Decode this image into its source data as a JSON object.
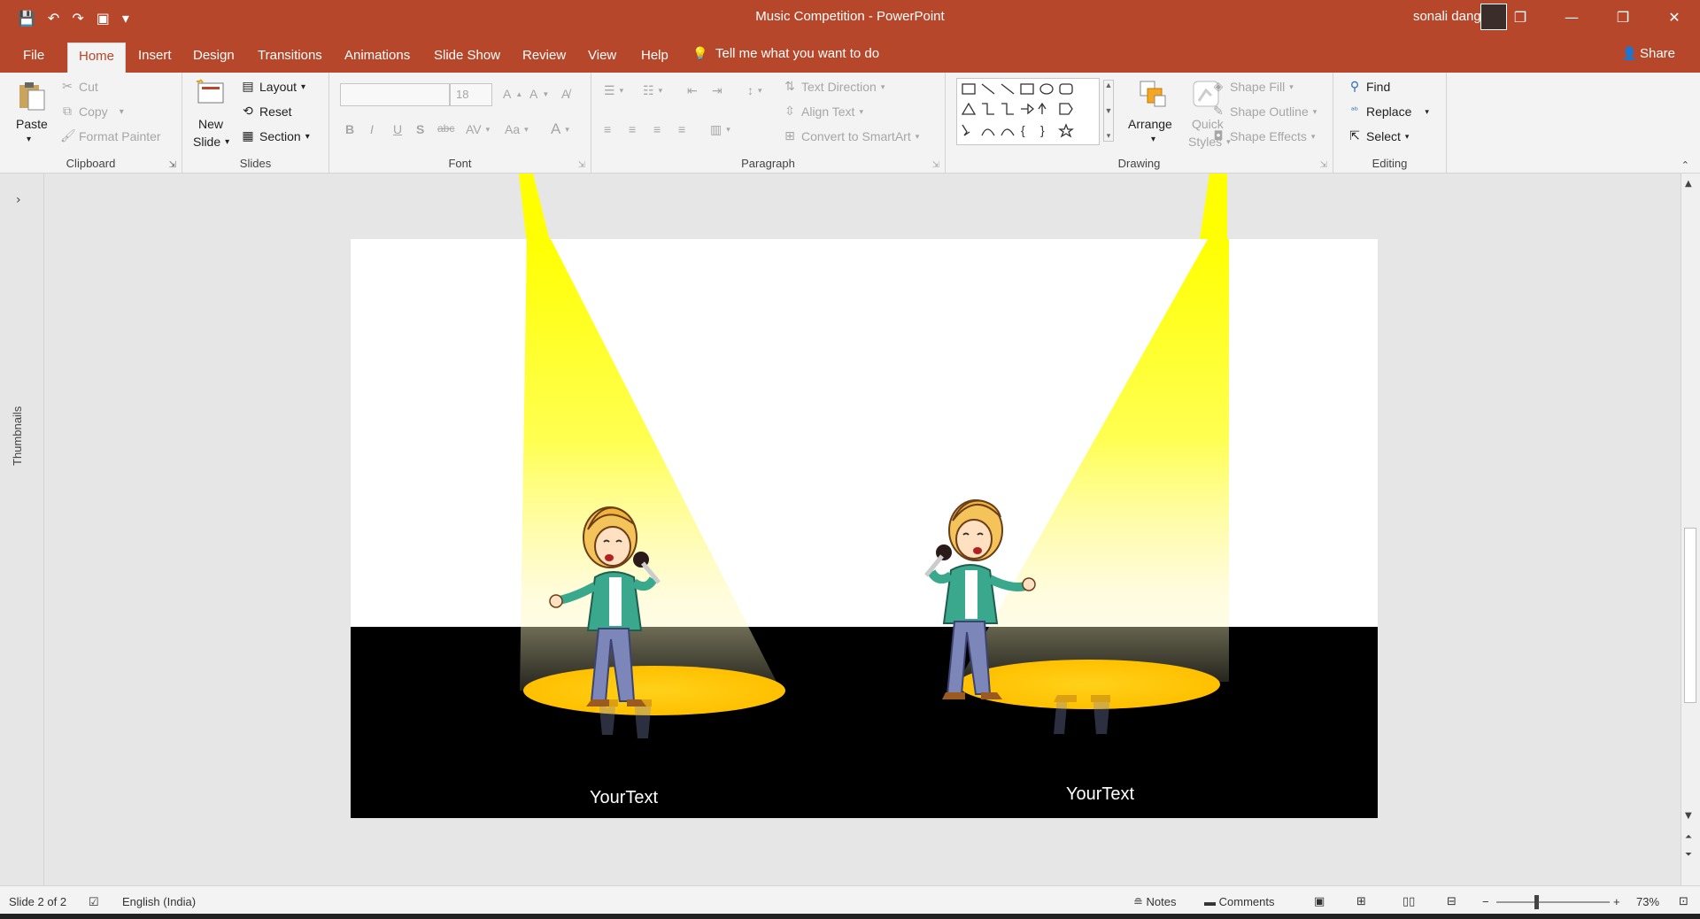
{
  "window": {
    "title": "Music Competition  -  PowerPoint",
    "user": "sonali dangi",
    "controls": [
      "❐",
      "—",
      "❐",
      "✕"
    ]
  },
  "qat": [
    "💾",
    "↶",
    "↷",
    "▣",
    "▾"
  ],
  "tabs": [
    "File",
    "Home",
    "Insert",
    "Design",
    "Transitions",
    "Animations",
    "Slide Show",
    "Review",
    "View",
    "Help"
  ],
  "tellme": "Tell me what you want to do",
  "share": "Share",
  "ribbon": {
    "clipboard": {
      "label": "Clipboard",
      "paste": "Paste",
      "cut": "Cut",
      "copy": "Copy",
      "format_painter": "Format Painter"
    },
    "slides": {
      "label": "Slides",
      "new_slide": "New",
      "new_slide2": "Slide",
      "layout": "Layout",
      "reset": "Reset",
      "section": "Section"
    },
    "font": {
      "label": "Font",
      "font_name": "",
      "font_size": "18"
    },
    "paragraph": {
      "label": "Paragraph",
      "text_direction": "Text Direction",
      "align_text": "Align Text",
      "convert_smartart": "Convert to SmartArt"
    },
    "drawing": {
      "label": "Drawing",
      "arrange": "Arrange",
      "quick_styles": "Quick",
      "quick_styles2": "Styles",
      "shape_fill": "Shape Fill",
      "shape_outline": "Shape Outline",
      "shape_effects": "Shape Effects"
    },
    "editing": {
      "label": "Editing",
      "find": "Find",
      "replace": "Replace",
      "select": "Select"
    }
  },
  "thumbnails_label": "Thumbnails",
  "slide": {
    "left_text": "YourText",
    "right_text": "YourText"
  },
  "status": {
    "slide_info": "Slide 2 of 2",
    "language": "English (India)",
    "notes": "Notes",
    "comments": "Comments",
    "zoom": "73%"
  },
  "colors": {
    "accent": "#b7472a",
    "spotlight": "#ffff00",
    "stage_light": "#ffc000"
  }
}
